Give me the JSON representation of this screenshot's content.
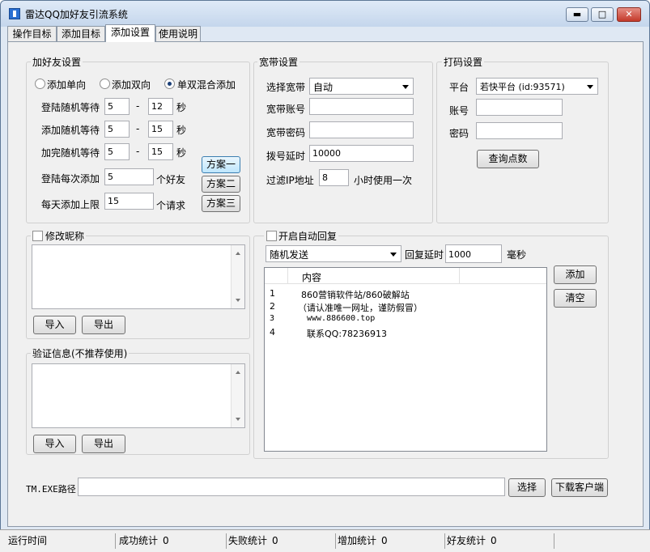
{
  "window": {
    "title": "雷达QQ加好友引流系统",
    "min_glyph": "▬",
    "max_glyph": "□",
    "close_glyph": "✕"
  },
  "tabs": [
    "操作目标",
    "添加目标",
    "添加设置",
    "使用说明"
  ],
  "add_friend": {
    "group_label": "加好友设置",
    "radios": [
      "添加单向",
      "添加双向",
      "单双混合添加"
    ],
    "rows": [
      {
        "label": "登陆随机等待",
        "min": "5",
        "max": "12",
        "unit": "秒"
      },
      {
        "label": "添加随机等待",
        "min": "5",
        "max": "15",
        "unit": "秒"
      },
      {
        "label": "加完随机等待",
        "min": "5",
        "max": "15",
        "unit": "秒"
      }
    ],
    "dash": "-",
    "per_login_label": "登陆每次添加",
    "per_login_value": "5",
    "per_login_unit": "个好友",
    "daily_label": "每天添加上限",
    "daily_value": "15",
    "daily_unit": "个请求",
    "plans": [
      "方案一",
      "方案二",
      "方案三"
    ]
  },
  "broadband": {
    "group_label": "宽带设置",
    "select_label": "选择宽带",
    "select_value": "自动",
    "account_label": "宽带账号",
    "password_label": "宽带密码",
    "delay_label": "拨号延时",
    "delay_value": "10000",
    "filter_label": "过滤IP地址",
    "filter_value": "8",
    "filter_unit": "小时使用一次"
  },
  "captcha": {
    "group_label": "打码设置",
    "platform_label": "平台",
    "platform_value": "若快平台  (id:93571)",
    "account_label": "账号",
    "password_label": "密码",
    "points_button": "查询点数"
  },
  "nickname": {
    "label": "修改昵称",
    "import": "导入",
    "export": "导出"
  },
  "verify": {
    "label": "验证信息(不推荐使用)",
    "import": "导入",
    "export": "导出"
  },
  "auto_reply": {
    "label": "开启自动回复",
    "mode_value": "随机发送",
    "delay_label": "回复延时",
    "delay_value": "1000",
    "delay_unit": "毫秒",
    "column": "内容",
    "rows": [
      {
        "n": "1",
        "text": "860营销软件站/860破解站"
      },
      {
        "n": "2",
        "text": "（请认准唯一网址，谨防假冒）"
      },
      {
        "n": "3",
        "text": "www.886600.top"
      },
      {
        "n": "4",
        "text": "联系QQ:78236913"
      }
    ],
    "add_button": "添加",
    "clear_button": "清空"
  },
  "tm_path": {
    "label": "TM.EXE路径",
    "select_button": "选择",
    "download_button": "下载客户端"
  },
  "statusbar": [
    {
      "label": "运行时间",
      "value": ""
    },
    {
      "label": "成功统计",
      "value": "0"
    },
    {
      "label": "失败统计",
      "value": "0"
    },
    {
      "label": "增加统计",
      "value": "0"
    },
    {
      "label": "好友统计",
      "value": "0"
    }
  ]
}
